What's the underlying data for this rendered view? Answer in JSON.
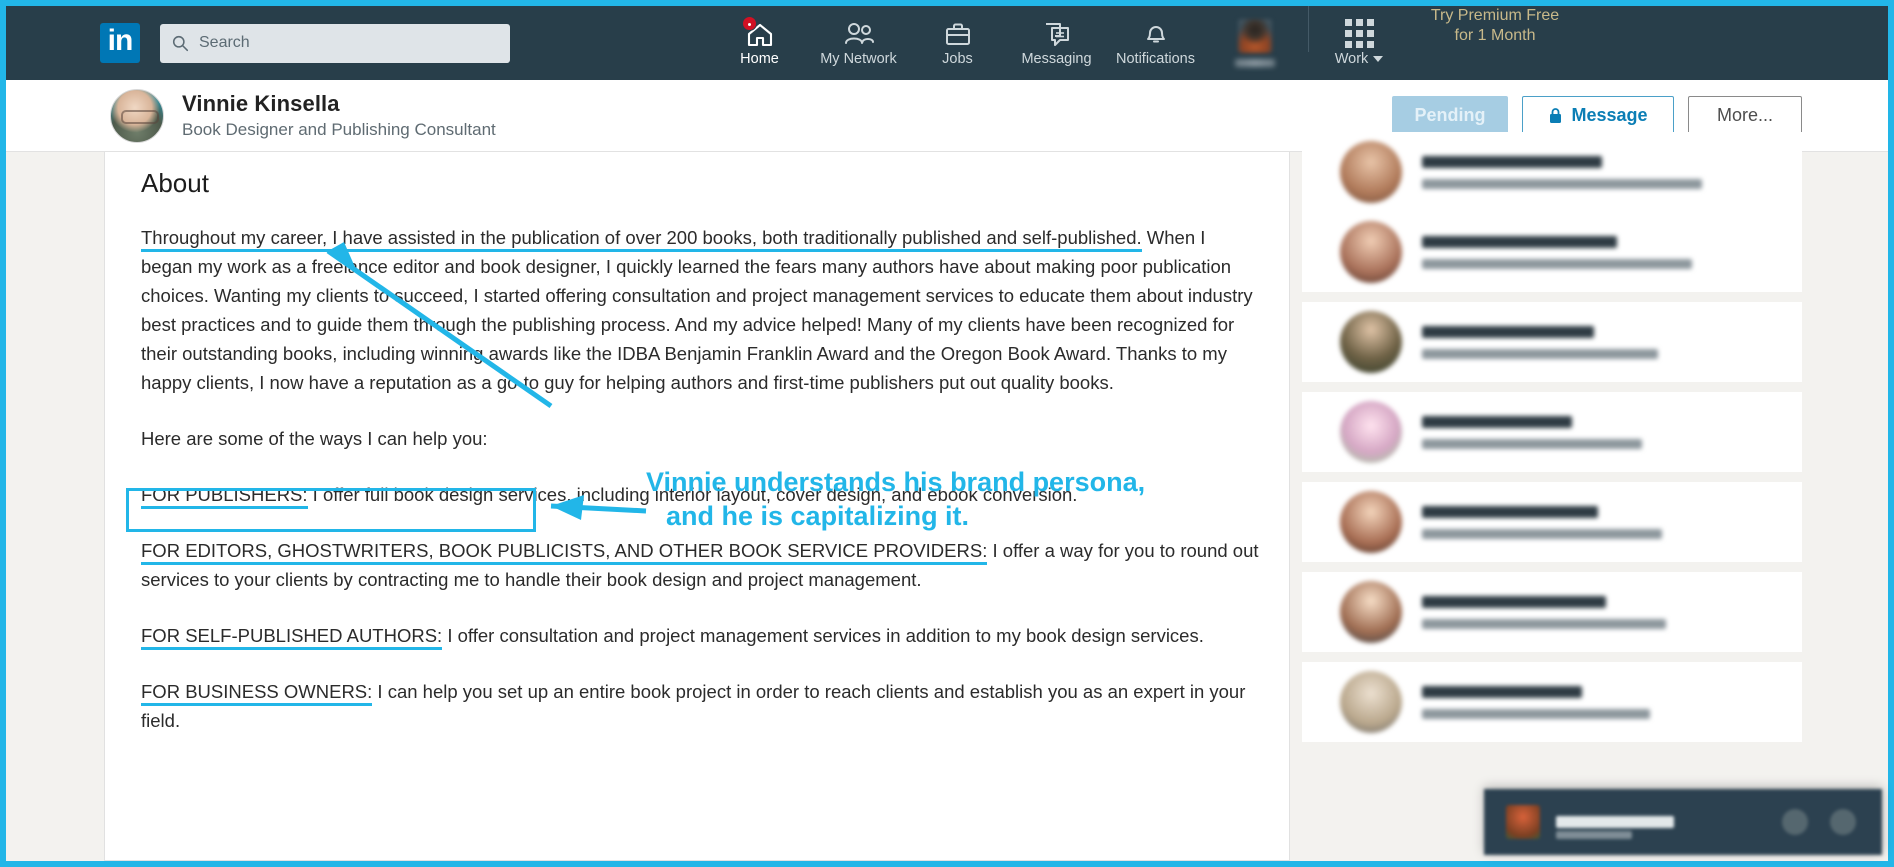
{
  "theme": {
    "nav_bg": "#283e4a",
    "brand_blue": "#0077b5",
    "annotation_cyan": "#22b6e8",
    "premium_gold": "#c8b98a",
    "page_bg": "#f3f2ef"
  },
  "topnav": {
    "logo_text": "in",
    "search": {
      "placeholder": "Search",
      "value": "",
      "icon": "search-icon"
    },
    "items": [
      {
        "label": "Home",
        "icon": "home-icon",
        "active": true,
        "badge": true
      },
      {
        "label": "My Network",
        "icon": "people-icon",
        "active": false,
        "badge": false
      },
      {
        "label": "Jobs",
        "icon": "briefcase-icon",
        "active": false,
        "badge": false
      },
      {
        "label": "Messaging",
        "icon": "speech-bubbles-icon",
        "active": false,
        "badge": false
      },
      {
        "label": "Notifications",
        "icon": "bell-icon",
        "active": false,
        "badge": false
      }
    ],
    "me_avatar_icon": "avatar-icon",
    "work": {
      "label": "Work",
      "icon": "app-grid-icon",
      "caret_icon": "chevron-down-icon"
    },
    "premium": {
      "line1": "Try Premium Free",
      "line2": "for 1 Month"
    }
  },
  "profile_bar": {
    "avatar_icon": "profile-avatar",
    "name": "Vinnie Kinsella",
    "headline": "Book Designer and Publishing Consultant",
    "actions": {
      "pending_label": "Pending",
      "message_label": "Message",
      "message_icon": "lock-icon",
      "more_label": "More..."
    }
  },
  "about": {
    "title": "About",
    "paragraph1_part_a": "Throughout my career, I have assisted in the publication of over 200 books, both traditionally published and self-published.",
    "paragraph1_part_b": " When I began my work as a freelance editor and book designer, I quickly learned the fears many authors have about making poor publication choices. Wanting my clients to succeed, I started offering consultation and project management services to educate them about industry best practices and to guide them through the publishing process. And my advice helped! Many of my clients have been recognized for their outstanding books, including winning awards like the IDBA Benjamin Franklin Award and the Oregon Book Award. Thanks to my happy clients, I now have a reputation as a go-to guy for helping authors and first-time publishers put out quality books.",
    "help_line": "Here are some of the ways I can help you:",
    "sections": [
      {
        "heading": "FOR PUBLISHERS:",
        "text": " I offer full book design services, including interior layout, cover design, and ebook conversion."
      },
      {
        "heading": "FOR EDITORS, GHOSTWRITERS, BOOK PUBLICISTS, AND OTHER BOOK SERVICE PROVIDERS:",
        "text": " I offer a way for you to round out services to your clients by contracting me to handle their book design and project management."
      },
      {
        "heading": "FOR SELF-PUBLISHED AUTHORS:",
        "text": " I offer consultation and project management services in addition to my book design services."
      },
      {
        "heading": "FOR BUSINESS OWNERS:",
        "text": " I can help you set up an entire book project in order to reach clients and establish you as an expert in your field."
      }
    ]
  },
  "annotation": {
    "callout_line1": "Vinnie understands his brand persona,",
    "callout_line2": "and he is capitalizing it.",
    "color": "#22b6e8"
  },
  "messaging_dock": {
    "title": "Messaging",
    "avatar_icon": "dock-avatar-icon",
    "buttons": [
      "compose-icon",
      "chevron-up-icon"
    ]
  }
}
